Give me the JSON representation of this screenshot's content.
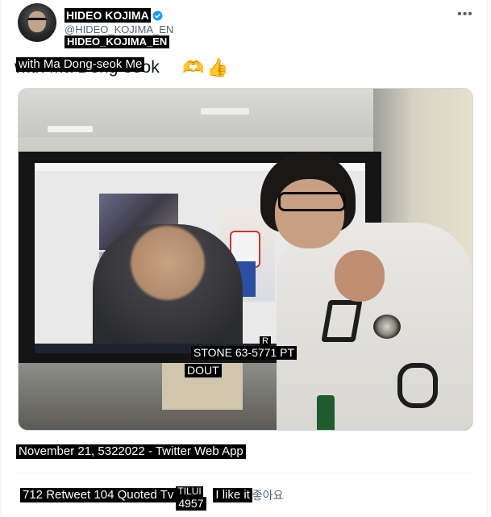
{
  "author": {
    "display_name": "HIDEO KOJIMA",
    "handle": "@HIDEO_KOJIMA_EN",
    "handle_overlay": "HIDEO_KOJIMA_EN",
    "verified": true,
    "avatar_icon": "avatar-photo"
  },
  "menu_icon": "more-options-icon",
  "tweet": {
    "text_background": "with Ma Dong-seok",
    "text_overlay": "with Ma Dong-seok Me",
    "emojis": [
      "🫶",
      "👍"
    ]
  },
  "photo": {
    "label_1": "STONE 63-5771 PT",
    "label_2": "DOUT",
    "label_3": "R"
  },
  "meta": {
    "line": "November 21, 5322022 - Twitter Web App"
  },
  "stats": {
    "retweets_quotes": "712 Retweet 104 Quoted Tv",
    "likes_top": "TILUI",
    "likes_count": "4957",
    "like_label": "I like it",
    "like_suffix": "좋아요"
  },
  "colors": {
    "verified": "#1d9bf0",
    "secondary_text": "#536471",
    "divider": "#eff3f4"
  }
}
